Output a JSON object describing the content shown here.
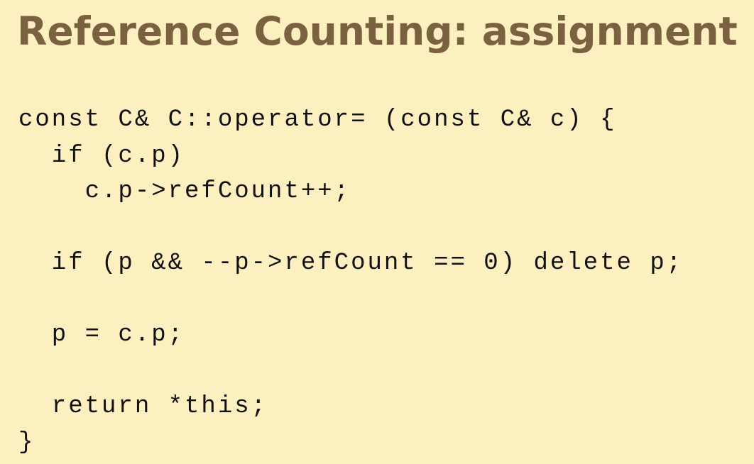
{
  "slide": {
    "title": "Reference Counting: assignment",
    "code_lines": [
      "const C& C::operator= (const C& c) {",
      "  if (c.p)",
      "    c.p->refCount++;",
      "",
      "  if (p && --p->refCount == 0) delete p;",
      "",
      "  p = c.p;",
      "",
      "  return *this;",
      "}"
    ]
  },
  "colors": {
    "background": "#fdf0c0",
    "title": "#7a6140",
    "code_text": "#111111"
  }
}
